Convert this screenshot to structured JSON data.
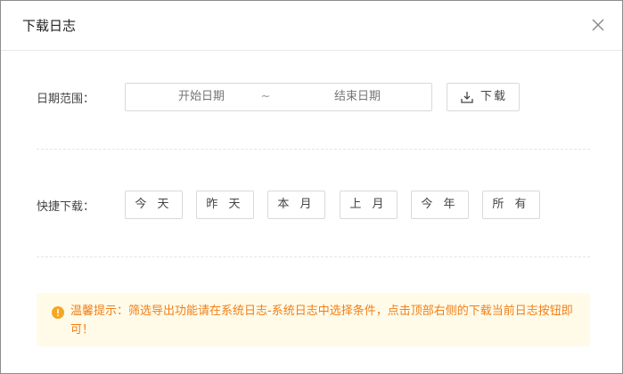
{
  "dialog": {
    "title": "下载日志",
    "close_icon": "close-icon"
  },
  "date_range": {
    "label": "日期范围：",
    "start_placeholder": "开始日期",
    "separator": "~",
    "end_placeholder": "结束日期",
    "download_label": "下载",
    "download_icon": "download-icon"
  },
  "quick_download": {
    "label": "快捷下载：",
    "buttons": [
      "今 天",
      "昨 天",
      "本 月",
      "上 月",
      "今 年",
      "所 有"
    ]
  },
  "notice": {
    "icon": "warning-icon",
    "text": "温馨提示：筛选导出功能请在系统日志-系统日志中选择条件，点击顶部右侧的下载当前日志按钮即可！",
    "color": "#f07f1a",
    "background": "#fffbe8"
  }
}
